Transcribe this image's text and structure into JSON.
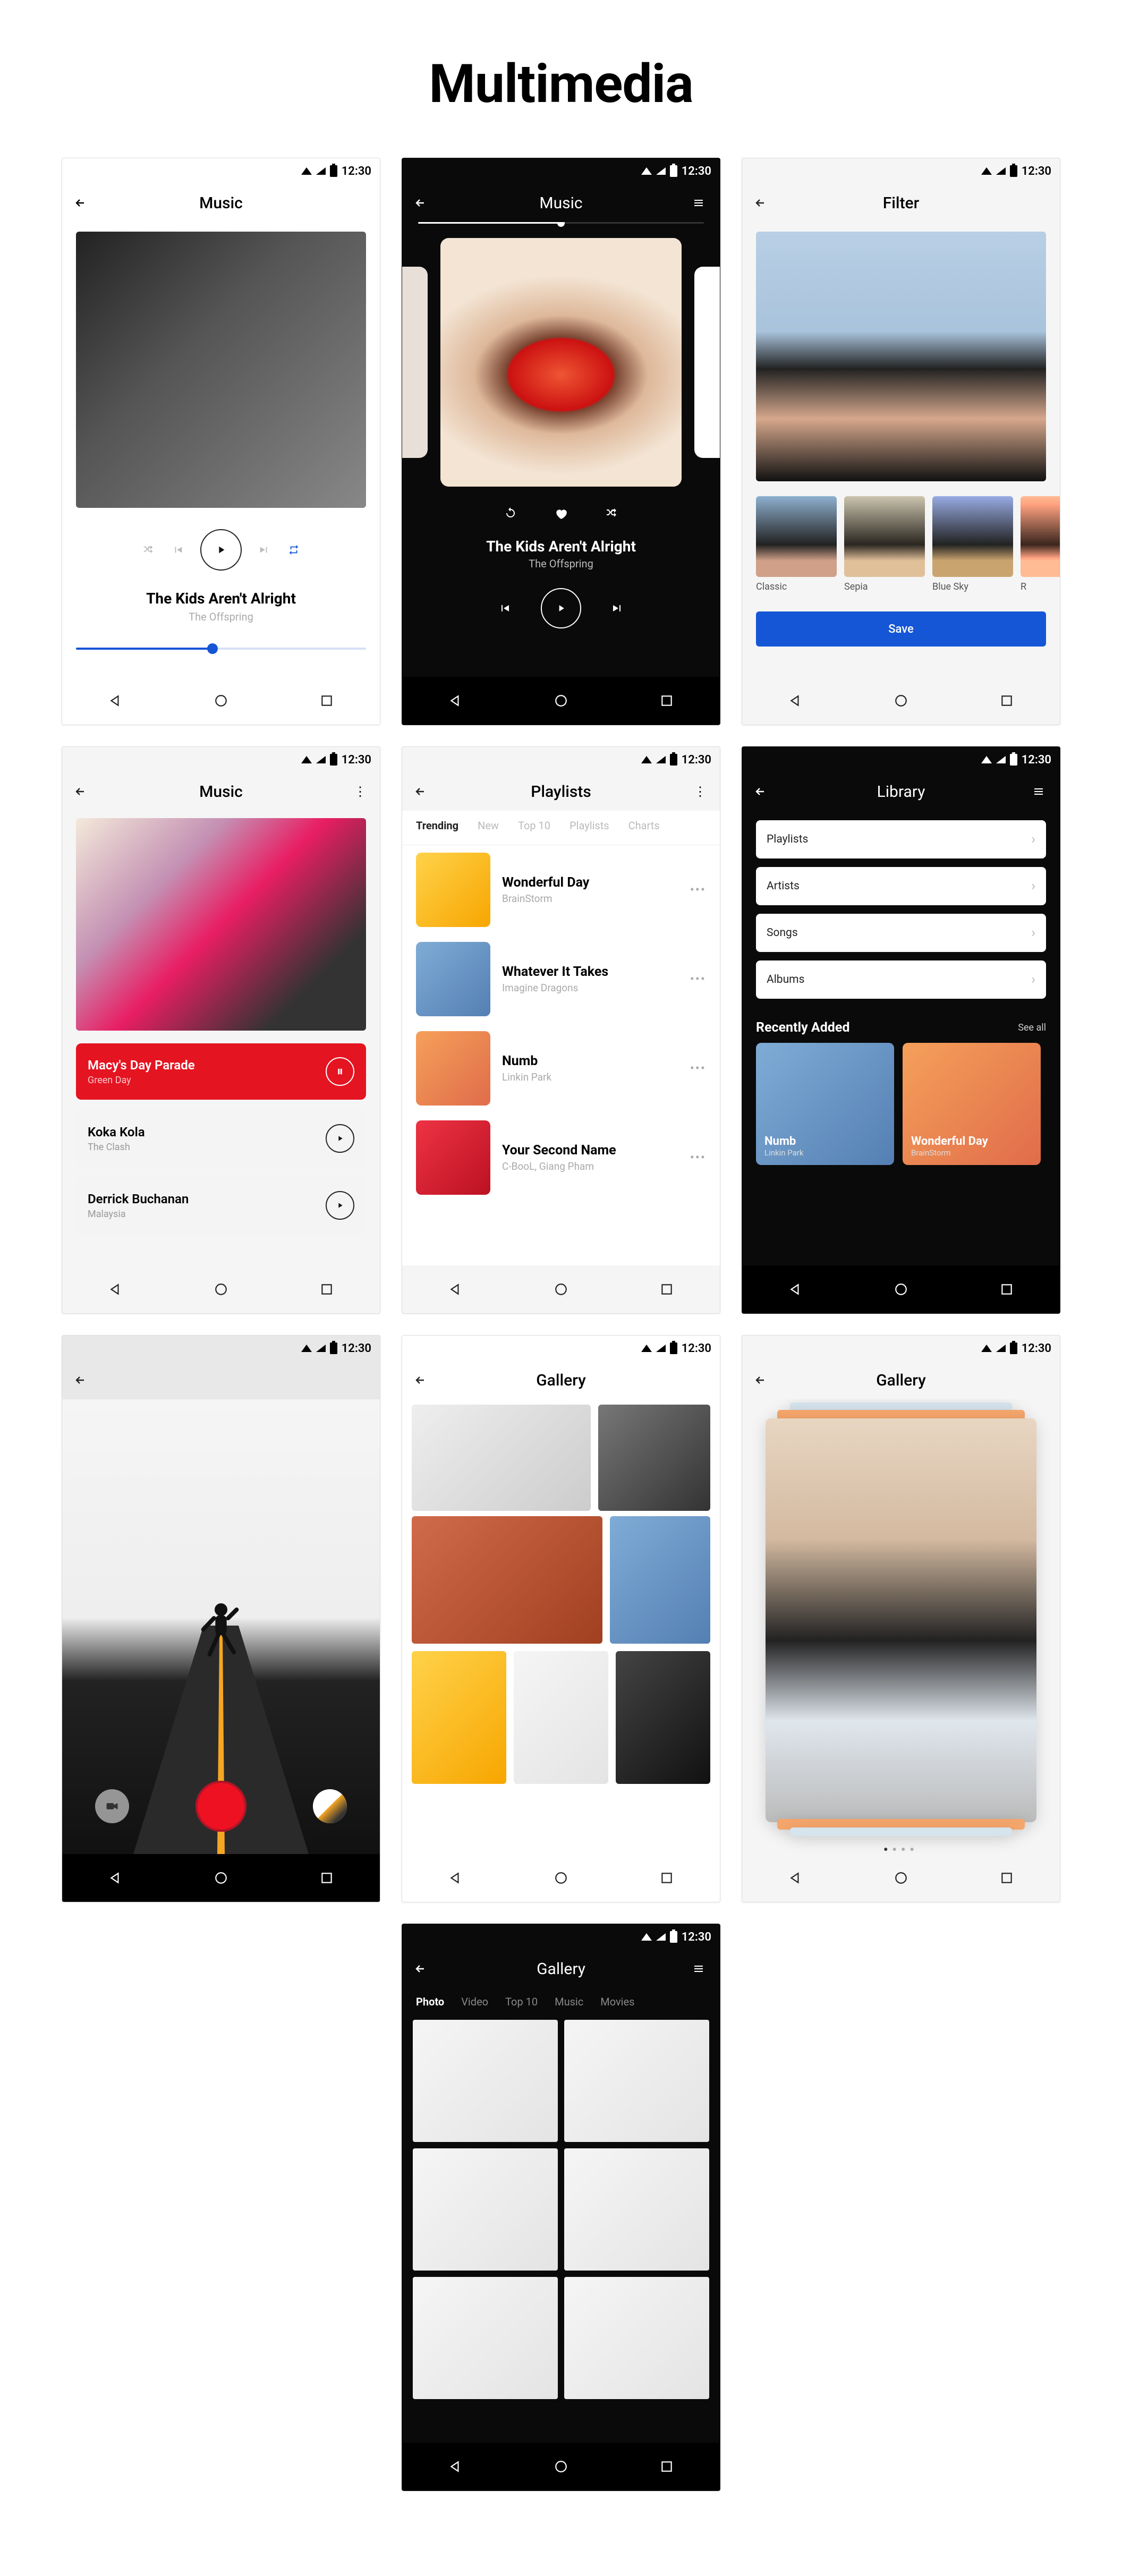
{
  "page_title": "Multimedia",
  "status_time": "12:30",
  "s1": {
    "title": "Music",
    "track_title": "The Kids Aren't Alright",
    "track_artist": "The Offspring"
  },
  "s2": {
    "title": "Music",
    "track_title": "The Kids Aren't Alright",
    "track_artist": "The Offspring"
  },
  "s3": {
    "title": "Filter",
    "filters": [
      "Classic",
      "Sepia",
      "Blue Sky",
      "R"
    ],
    "save_label": "Save"
  },
  "s4": {
    "title": "Music",
    "tracks": [
      {
        "title": "Macy's Day Parade",
        "artist": "Green Day",
        "active": true
      },
      {
        "title": "Koka Kola",
        "artist": "The Clash",
        "active": false
      },
      {
        "title": "Derrick Buchanan",
        "artist": "Malaysia",
        "active": false
      }
    ]
  },
  "s5": {
    "title": "Playlists",
    "tabs": [
      "Trending",
      "New",
      "Top 10",
      "Playlists",
      "Charts"
    ],
    "items": [
      {
        "title": "Wonderful Day",
        "artist": "BrainStorm"
      },
      {
        "title": "Whatever It Takes",
        "artist": "Imagine Dragons"
      },
      {
        "title": "Numb",
        "artist": "Linkin Park"
      },
      {
        "title": "Your Second Name",
        "artist": "C-BooL, Giang Pham"
      }
    ]
  },
  "s6": {
    "title": "Library",
    "menu": [
      "Playlists",
      "Artists",
      "Songs",
      "Albums"
    ],
    "section_title": "Recently Added",
    "see_all": "See all",
    "tiles": [
      {
        "title": "Numb",
        "artist": "Linkin Park"
      },
      {
        "title": "Wonderful Day",
        "artist": "BrainStorm"
      }
    ]
  },
  "s8": {
    "title": "Gallery"
  },
  "s9": {
    "title": "Gallery"
  },
  "s10": {
    "title": "Gallery",
    "tabs": [
      "Photo",
      "Video",
      "Top 10",
      "Music",
      "Movies"
    ]
  }
}
